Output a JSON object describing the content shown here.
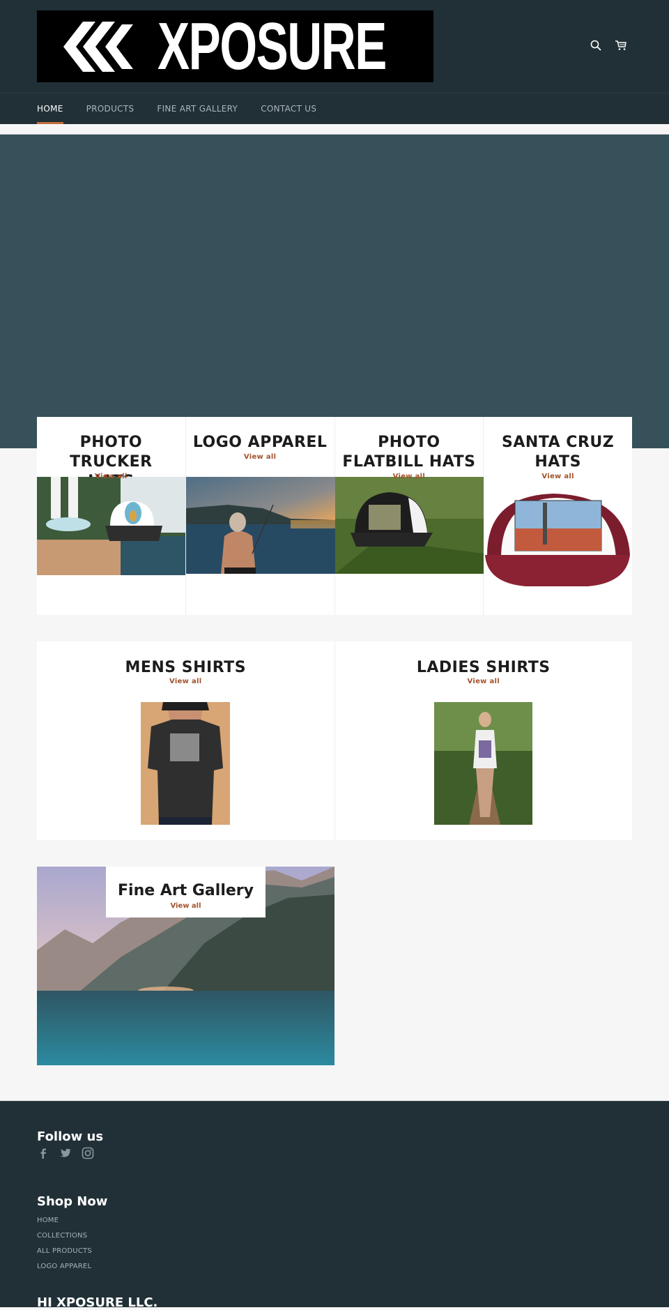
{
  "header": {
    "logo_text": "XPOSURE",
    "icons": [
      "search-icon",
      "cart-icon"
    ]
  },
  "nav": {
    "items": [
      {
        "label": "HOME",
        "active": true
      },
      {
        "label": "PRODUCTS",
        "active": false
      },
      {
        "label": "FINE ART GALLERY",
        "active": false
      },
      {
        "label": "CONTACT US",
        "active": false
      }
    ]
  },
  "colors": {
    "header_bg": "#213037",
    "hero_bg": "#37515a",
    "accent": "#c26d3d",
    "link": "#a3522b",
    "page_bg": "#f6f6f6"
  },
  "collections_row1": [
    {
      "title": "PHOTO TRUCKER HATS",
      "link": "View all",
      "image": "skateboard-trucker-hat-photo"
    },
    {
      "title": "LOGO APPAREL",
      "link": "View all",
      "image": "man-fishing-sunset-photo"
    },
    {
      "title": "PHOTO FLATBILL HATS",
      "link": "View all",
      "image": "flatbill-hat-on-fern-photo"
    },
    {
      "title": "SANTA CRUZ HATS",
      "link": "View all",
      "image": "maroon-trucker-hat-palm-trees-photo"
    }
  ],
  "collections_row2": [
    {
      "title": "MENS SHIRTS",
      "link": "View all",
      "image": "man-black-tshirt-photo"
    },
    {
      "title": "LADIES SHIRTS",
      "link": "View all",
      "image": "woman-tank-top-forest-photo"
    }
  ],
  "fine_art": {
    "title": "Fine Art Gallery",
    "link": "View all",
    "image": "napali-coast-ocean-photo"
  },
  "footer": {
    "follow_heading": "Follow us",
    "social": [
      "facebook-icon",
      "twitter-icon",
      "instagram-icon"
    ],
    "shop_heading": "Shop Now",
    "shop_links": [
      "HOME",
      "COLLECTIONS",
      "ALL PRODUCTS",
      "LOGO APPAREL"
    ],
    "company_heading": "HI XPOSURE LLC."
  }
}
